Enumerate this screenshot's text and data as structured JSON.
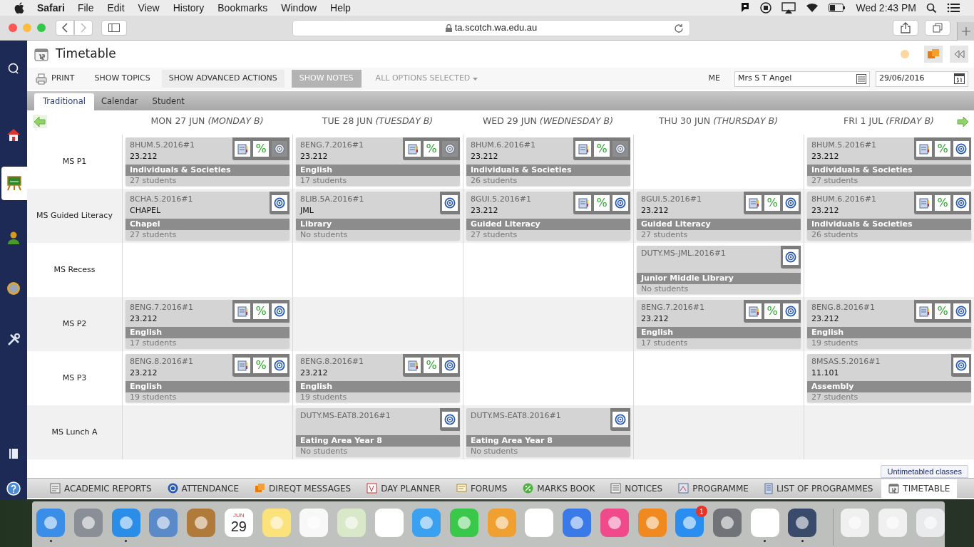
{
  "menu_bar": {
    "app": "Safari",
    "items": [
      "File",
      "Edit",
      "View",
      "History",
      "Bookmarks",
      "Window",
      "Help"
    ],
    "clock": "Wed 2:43 PM"
  },
  "browser": {
    "url": "ta.scotch.wa.edu.au"
  },
  "sidebar": [
    {
      "kind": "search",
      "selected": false
    },
    {
      "kind": "home",
      "selected": false
    },
    {
      "kind": "board",
      "selected": true
    },
    {
      "kind": "person",
      "selected": false
    },
    {
      "kind": "medal",
      "selected": false
    },
    {
      "kind": "tools",
      "selected": false
    },
    {
      "kind": "book",
      "selected": false
    },
    {
      "kind": "help",
      "selected": false
    }
  ],
  "page_title": "Timetable",
  "toolbar": {
    "buttons": [
      {
        "label": "PRINT",
        "kind": "print"
      },
      {
        "label": "SHOW TOPICS",
        "kind": "plain"
      },
      {
        "label": "SHOW ADVANCED ACTIONS",
        "kind": "hover"
      },
      {
        "label": "SHOW NOTES",
        "kind": "toggle"
      }
    ],
    "options": "ALL OPTIONS SELECTED",
    "me_label": "ME",
    "person": "Mrs S T Angel",
    "date": "29/06/2016"
  },
  "view_tabs": [
    {
      "label": "Traditional",
      "selected": true
    },
    {
      "label": "Calendar",
      "selected": false
    },
    {
      "label": "Student",
      "selected": false
    }
  ],
  "days": [
    "MON 27 JUN *(MONDAY B)*",
    "TUE 28 JUN *(TUESDAY B)*",
    "WED 29 JUN *(WEDNESDAY B)*",
    "THU 30 JUN *(THURSDAY B)*",
    "FRI 1 JUL *(FRIDAY B)*"
  ],
  "periods": [
    {
      "label": "MS P1",
      "cells": [
        {
          "kind": "class",
          "code": "8HUM.5.2016#1",
          "room": "23.212",
          "subject": "Individuals & Societies",
          "students": "27 students",
          "actions": [
            {
              "kind": "planner",
              "disabled": false
            },
            {
              "kind": "marks",
              "symbol": "%",
              "disabled": false
            },
            {
              "kind": "email",
              "disabled": true
            }
          ]
        },
        {
          "kind": "class",
          "code": "8ENG.7.2016#1",
          "room": "23.212",
          "subject": "English",
          "students": "17 students",
          "actions": [
            {
              "kind": "planner",
              "disabled": false
            },
            {
              "kind": "marks",
              "symbol": "%",
              "disabled": false
            },
            {
              "kind": "email",
              "disabled": true
            }
          ]
        },
        {
          "kind": "class",
          "code": "8HUM.6.2016#1",
          "room": "23.212",
          "subject": "Individuals & Societies",
          "students": "26 students",
          "actions": [
            {
              "kind": "planner",
              "disabled": false
            },
            {
              "kind": "marks",
              "symbol": "%",
              "disabled": false
            },
            {
              "kind": "email",
              "disabled": true
            }
          ]
        },
        {
          "kind": "empty"
        },
        {
          "kind": "class",
          "code": "8HUM.5.2016#1",
          "room": "23.212",
          "subject": "Individuals & Societies",
          "students": "27 students",
          "actions": [
            {
              "kind": "planner",
              "disabled": false
            },
            {
              "kind": "marks",
              "symbol": "%",
              "disabled": false
            },
            {
              "kind": "email",
              "disabled": false
            }
          ]
        }
      ]
    },
    {
      "label": "MS Guided Literacy",
      "cells": [
        {
          "kind": "class",
          "code": "8CHA.5.2016#1",
          "room": "CHAPEL",
          "subject": "Chapel",
          "students": "27 students",
          "actions": [
            {
              "kind": "email",
              "disabled": false
            }
          ]
        },
        {
          "kind": "class",
          "code": "8LIB.5A.2016#1",
          "room": "JML",
          "subject": "Library",
          "students": "No students",
          "actions": [
            {
              "kind": "email",
              "disabled": false
            }
          ]
        },
        {
          "kind": "class",
          "code": "8GUI.5.2016#1",
          "room": "23.212",
          "subject": "Guided Literacy",
          "students": "27 students",
          "actions": [
            {
              "kind": "planner",
              "disabled": false
            },
            {
              "kind": "marks",
              "symbol": "%",
              "disabled": false
            },
            {
              "kind": "email",
              "disabled": false
            }
          ]
        },
        {
          "kind": "class",
          "code": "8GUI.5.2016#1",
          "room": "23.212",
          "subject": "Guided Literacy",
          "students": "27 students",
          "actions": [
            {
              "kind": "planner",
              "disabled": false
            },
            {
              "kind": "marks",
              "symbol": "%",
              "disabled": false
            },
            {
              "kind": "email",
              "disabled": false
            }
          ]
        },
        {
          "kind": "class",
          "code": "8HUM.6.2016#1",
          "room": "23.212",
          "subject": "Individuals & Societies",
          "students": "26 students",
          "actions": [
            {
              "kind": "planner",
              "disabled": false
            },
            {
              "kind": "marks",
              "symbol": "%",
              "disabled": false
            },
            {
              "kind": "email",
              "disabled": false
            }
          ]
        }
      ]
    },
    {
      "label": "MS Recess",
      "cells": [
        {
          "kind": "empty"
        },
        {
          "kind": "empty"
        },
        {
          "kind": "empty"
        },
        {
          "kind": "class",
          "code": "DUTY.MS-JML.2016#1",
          "subject": "Junior Middle Library",
          "students": "No students",
          "actions": [
            {
              "kind": "email",
              "disabled": false
            }
          ]
        },
        {
          "kind": "empty"
        }
      ]
    },
    {
      "label": "MS P2",
      "cells": [
        {
          "kind": "class",
          "code": "8ENG.7.2016#1",
          "room": "23.212",
          "subject": "English",
          "students": "17 students",
          "actions": [
            {
              "kind": "planner",
              "disabled": false
            },
            {
              "kind": "marks",
              "symbol": "%",
              "disabled": false
            },
            {
              "kind": "email",
              "disabled": false
            }
          ]
        },
        {
          "kind": "empty"
        },
        {
          "kind": "empty"
        },
        {
          "kind": "class",
          "code": "8ENG.7.2016#1",
          "room": "23.212",
          "subject": "English",
          "students": "17 students",
          "actions": [
            {
              "kind": "planner",
              "disabled": false
            },
            {
              "kind": "marks",
              "symbol": "%",
              "disabled": false
            },
            {
              "kind": "email",
              "disabled": false
            }
          ]
        },
        {
          "kind": "class",
          "code": "8ENG.8.2016#1",
          "room": "23.212",
          "subject": "English",
          "students": "19 students",
          "actions": [
            {
              "kind": "planner",
              "disabled": false
            },
            {
              "kind": "marks",
              "symbol": "%",
              "disabled": false
            },
            {
              "kind": "email",
              "disabled": false
            }
          ]
        }
      ]
    },
    {
      "label": "MS P3",
      "cells": [
        {
          "kind": "class",
          "code": "8ENG.8.2016#1",
          "room": "23.212",
          "subject": "English",
          "students": "19 students",
          "actions": [
            {
              "kind": "planner",
              "disabled": false
            },
            {
              "kind": "marks",
              "symbol": "%",
              "disabled": false
            },
            {
              "kind": "email",
              "disabled": false
            }
          ]
        },
        {
          "kind": "class",
          "code": "8ENG.8.2016#1",
          "room": "23.212",
          "subject": "English",
          "students": "19 students",
          "actions": [
            {
              "kind": "planner",
              "disabled": false
            },
            {
              "kind": "marks",
              "symbol": "%",
              "disabled": false
            },
            {
              "kind": "email",
              "disabled": false
            }
          ]
        },
        {
          "kind": "empty"
        },
        {
          "kind": "empty"
        },
        {
          "kind": "class",
          "code": "8MSAS.5.2016#1",
          "room": "11.101",
          "subject": "Assembly",
          "students": "27 students",
          "actions": [
            {
              "kind": "email",
              "disabled": false
            }
          ]
        }
      ]
    },
    {
      "label": "MS Lunch A",
      "cells": [
        {
          "kind": "empty"
        },
        {
          "kind": "class",
          "code": "DUTY.MS-EAT8.2016#1",
          "subject": "Eating Area Year 8",
          "students": "No students",
          "actions": [
            {
              "kind": "email",
              "disabled": false
            }
          ]
        },
        {
          "kind": "class",
          "code": "DUTY.MS-EAT8.2016#1",
          "subject": "Eating Area Year 8",
          "students": "No students",
          "actions": [
            {
              "kind": "email",
              "disabled": false
            }
          ]
        },
        {
          "kind": "empty"
        },
        {
          "kind": "empty"
        }
      ]
    }
  ],
  "untimetabled": "Untimetabled classes",
  "bottom_tabs": [
    {
      "label": "ACADEMIC REPORTS",
      "kind": "reports",
      "selected": false
    },
    {
      "label": "ATTENDANCE",
      "kind": "attendance",
      "selected": false
    },
    {
      "label": "DIREQT MESSAGES",
      "kind": "messages",
      "selected": false
    },
    {
      "label": "DAY PLANNER",
      "kind": "planner",
      "selected": false
    },
    {
      "label": "FORUMS",
      "kind": "forums",
      "selected": false
    },
    {
      "label": "MARKS BOOK",
      "kind": "marks",
      "selected": false
    },
    {
      "label": "NOTICES",
      "kind": "notices",
      "selected": false
    },
    {
      "label": "PROGRAMME",
      "kind": "programme",
      "selected": false
    },
    {
      "label": "LIST OF PROGRAMMES",
      "kind": "list",
      "selected": false
    },
    {
      "label": "TIMETABLE",
      "kind": "timetable",
      "selected": true
    }
  ],
  "dock": [
    {
      "kind": "finder",
      "running": true
    },
    {
      "kind": "launchpad",
      "running": false
    },
    {
      "kind": "safari",
      "running": true
    },
    {
      "kind": "mail",
      "running": false
    },
    {
      "kind": "contacts",
      "running": false
    },
    {
      "kind": "calendar",
      "month": "JUN",
      "day": "29",
      "running": false
    },
    {
      "kind": "notes",
      "running": false
    },
    {
      "kind": "reminders",
      "running": false
    },
    {
      "kind": "maps",
      "running": false
    },
    {
      "kind": "photos",
      "running": false
    },
    {
      "kind": "messages",
      "running": false
    },
    {
      "kind": "facetime",
      "running": false
    },
    {
      "kind": "pages",
      "running": false
    },
    {
      "kind": "numbers",
      "running": false
    },
    {
      "kind": "keynote",
      "running": false
    },
    {
      "kind": "itunes",
      "running": false
    },
    {
      "kind": "ibooks",
      "running": false
    },
    {
      "kind": "appstore",
      "badge": "1",
      "running": false
    },
    {
      "kind": "preferences",
      "running": false
    },
    {
      "kind": "office",
      "running": true
    },
    {
      "kind": "quicktime",
      "running": true
    },
    {
      "kind": "window",
      "running": false
    },
    {
      "kind": "window",
      "running": false
    },
    {
      "kind": "trash",
      "running": false
    }
  ]
}
